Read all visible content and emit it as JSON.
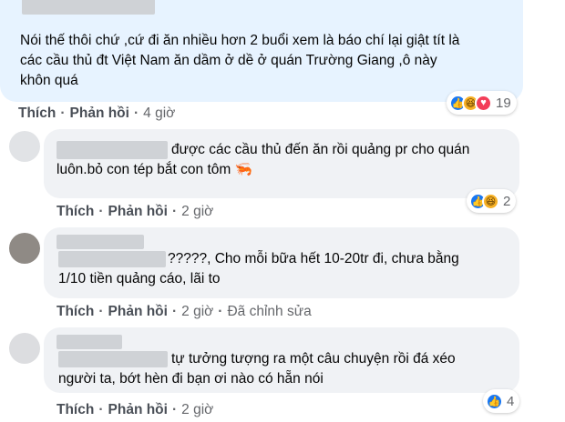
{
  "comments": [
    {
      "text_lines": [
        "Nói thế thôi chứ ,cứ đi ăn nhiều hơn 2 buổi xem là báo chí lại giật tít là",
        "các cầu thủ đt Việt Nam ăn dầm ở dề ở quán Trường Giang ,ô này",
        "khôn quá"
      ],
      "like_label": "Thích",
      "reply_label": "Phản hồi",
      "time": "4 giờ",
      "reaction_count": "19"
    },
    {
      "text_lines": [
        "được các cầu thủ đến ăn rồi quảng pr cho quán",
        "luôn.bỏ con tép bắt con tôm 🦐"
      ],
      "like_label": "Thích",
      "reply_label": "Phản hồi",
      "time": "2 giờ",
      "reaction_count": "2"
    },
    {
      "text_lines": [
        "?????, Cho mỗi bữa hết 10-20tr đi, chưa bằng",
        "1/10 tiền quảng cáo, lãi to"
      ],
      "like_label": "Thích",
      "reply_label": "Phản hồi",
      "time": "2 giờ",
      "edited_label": "Đã chỉnh sửa",
      "reaction_count": ""
    },
    {
      "text_lines": [
        "tự tưởng tượng ra một câu chuyện rồi đá xéo",
        "người ta, bớt hèn đi bạn ơi nào có hẵn nói"
      ],
      "like_label": "Thích",
      "reply_label": "Phản hồi",
      "time": "2 giờ",
      "reaction_count": "4"
    }
  ],
  "icons": [
    "like-icon",
    "haha-icon",
    "love-icon"
  ],
  "colors": {
    "main_bubble": "#e7f3ff",
    "reply_bubble": "#f0f2f5",
    "like_blue": "#1877f2"
  }
}
